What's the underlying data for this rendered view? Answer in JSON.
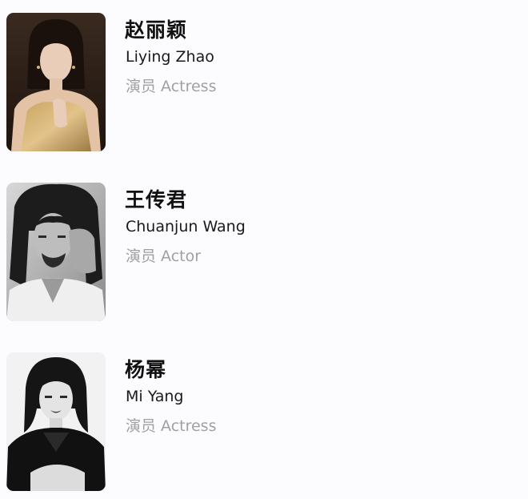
{
  "cast": [
    {
      "name_cn": "赵丽颖",
      "name_en": "Liying Zhao",
      "role": "演员 Actress"
    },
    {
      "name_cn": "王传君",
      "name_en": "Chuanjun Wang",
      "role": "演员 Actor"
    },
    {
      "name_cn": "杨幂",
      "name_en": "Mi Yang",
      "role": "演员 Actress"
    }
  ]
}
